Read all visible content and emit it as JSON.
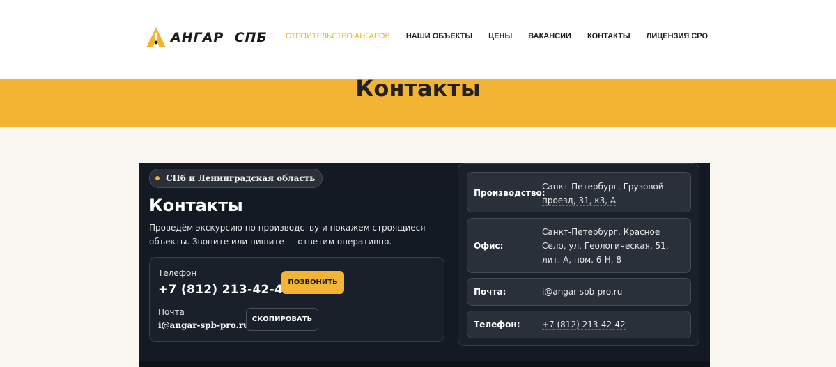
{
  "header": {
    "logo_text": "АНГАР  СПБ",
    "nav": [
      {
        "label": "СТРОИТЕЛЬСТВО АНГАРОВ",
        "active": true
      },
      {
        "label": "НАШИ ОБЪЕКТЫ",
        "active": false
      },
      {
        "label": "ЦЕНЫ",
        "active": false
      },
      {
        "label": "ВАКАНСИИ",
        "active": false
      },
      {
        "label": "КОНТАКТЫ",
        "active": false
      },
      {
        "label": "ЛИЦЕНЗИЯ СРО",
        "active": false
      }
    ]
  },
  "banner": {
    "title": "Контакты"
  },
  "card": {
    "pill": "СПб и Ленинградская область",
    "title": "Контакты",
    "description": "Проведём экскурсию по производству и покажем строящиеся объекты. Звоните или пишите — ответим оперативно.",
    "phone_label": "Телефон",
    "phone": "+7 (812) 213-42-42",
    "call_button": "ПОЗВОНИТЬ",
    "mail_label": "Почта",
    "mail": "i@angar-spb-pro.ru",
    "copy_button": "СКОПИРОВАТЬ"
  },
  "details": [
    {
      "key": "Производство:",
      "value": "Санкт-Петербург, Грузовой проезд, 31, к3, А"
    },
    {
      "key": "Офис:",
      "value": "Санкт-Петербург, Красное Село, ул. Геологическая, 51, лит. А, пом. 6-Н, 8"
    },
    {
      "key": "Почта:",
      "value": "i@angar-spb-pro.ru"
    },
    {
      "key": "Телефон:",
      "value": "+7 (812) 213-42-42"
    }
  ],
  "colors": {
    "accent": "#f3b433",
    "dark": "#141a23",
    "text": "#1e1e1e"
  }
}
